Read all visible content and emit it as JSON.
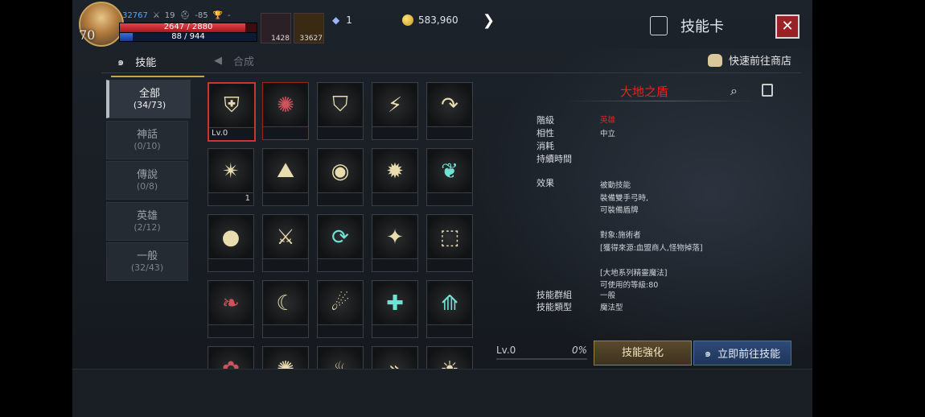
{
  "hud": {
    "level": "70",
    "combat_power": "32767",
    "attack": "19",
    "defense": "-85",
    "trophy": "-",
    "hp": "2647 / 2880",
    "mp": "88 / 944",
    "hp_ratio": 0.919,
    "mp_ratio": 0.093,
    "potion_count": "1428",
    "item_count": "33627",
    "crystal": "1",
    "gold": "583,960"
  },
  "header": {
    "title": "技能卡"
  },
  "tabs": {
    "skill": "技能",
    "synthesis": "合成",
    "shop": "快速前往商店"
  },
  "categories": [
    {
      "name": "全部",
      "count": "(34/73)"
    },
    {
      "name": "神話",
      "count": "(0/10)"
    },
    {
      "name": "傳說",
      "count": "(0/8)"
    },
    {
      "name": "英雄",
      "count": "(2/12)"
    },
    {
      "name": "一般",
      "count": "(32/43)"
    }
  ],
  "cards": [
    {
      "icon": "shield-bow-icon",
      "glyph": "⛨",
      "label": "Lv.0",
      "count": ""
    },
    {
      "icon": "fire-claw-icon",
      "glyph": "✺",
      "label": "",
      "count": ""
    },
    {
      "icon": "shield-icon",
      "glyph": "⛉",
      "label": "",
      "count": ""
    },
    {
      "icon": "lightning-icon",
      "glyph": "⚡",
      "label": "",
      "count": ""
    },
    {
      "icon": "arrow-curve-icon",
      "glyph": "↷",
      "label": "",
      "count": ""
    },
    {
      "icon": "burst-icon",
      "glyph": "✴",
      "label": "",
      "count": "1"
    },
    {
      "icon": "altar-icon",
      "glyph": "⛰",
      "label": "",
      "count": ""
    },
    {
      "icon": "eye-icon",
      "glyph": "◉",
      "label": "",
      "count": ""
    },
    {
      "icon": "spiral-icon",
      "glyph": "✹",
      "label": "",
      "count": ""
    },
    {
      "icon": "leaf-icon",
      "glyph": "❦",
      "label": "",
      "count": ""
    },
    {
      "icon": "orb-icon",
      "glyph": "●",
      "label": "",
      "count": ""
    },
    {
      "icon": "helmet-icon",
      "glyph": "⚔",
      "label": "",
      "count": ""
    },
    {
      "icon": "cycle-icon",
      "glyph": "⟳",
      "label": "",
      "count": ""
    },
    {
      "icon": "sparkle-icon",
      "glyph": "✦",
      "label": "",
      "count": ""
    },
    {
      "icon": "card-split-icon",
      "glyph": "⬚",
      "label": "",
      "count": ""
    },
    {
      "icon": "wing-icon",
      "glyph": "❧",
      "label": "",
      "count": ""
    },
    {
      "icon": "crescent-icon",
      "glyph": "☾",
      "label": "",
      "count": ""
    },
    {
      "icon": "comet-icon",
      "glyph": "☄",
      "label": "",
      "count": ""
    },
    {
      "icon": "cross-burst-icon",
      "glyph": "✚",
      "label": "",
      "count": ""
    },
    {
      "icon": "tower-icon",
      "glyph": "⟰",
      "label": "",
      "count": ""
    },
    {
      "icon": "flower-icon",
      "glyph": "✿",
      "label": "",
      "count": ""
    },
    {
      "icon": "web-icon",
      "glyph": "✺",
      "label": "",
      "count": ""
    },
    {
      "icon": "flames-icon",
      "glyph": "♨",
      "label": "",
      "count": ""
    },
    {
      "icon": "chevrons-icon",
      "glyph": "»",
      "label": "",
      "count": ""
    },
    {
      "icon": "sun-shield-icon",
      "glyph": "☀",
      "label": "",
      "count": ""
    }
  ],
  "detail": {
    "name": "大地之盾",
    "rows": [
      {
        "label": "階級",
        "value": "英雄",
        "red": true
      },
      {
        "label": "相性",
        "value": "中立",
        "red": false
      },
      {
        "label": "消耗",
        "value": "",
        "red": false
      },
      {
        "label": "持續時間",
        "value": "",
        "red": false
      }
    ],
    "effect_label": "效果",
    "effect_lines": [
      "被動技能",
      "裝備雙手弓時,",
      "可裝備盾牌",
      "",
      "對象:施術者",
      "[獲得來源:血盟商人,怪物掉落]",
      "",
      "[大地系列精靈魔法]",
      "可使用的等級:80"
    ],
    "group_label": "技能群組",
    "group_value": "一般",
    "type_label": "技能類型",
    "type_value": "魔法型"
  },
  "progress": {
    "level": "Lv.0",
    "percent": "0%"
  },
  "buttons": {
    "upgrade": "技能強化",
    "go": "立即前往技能"
  }
}
